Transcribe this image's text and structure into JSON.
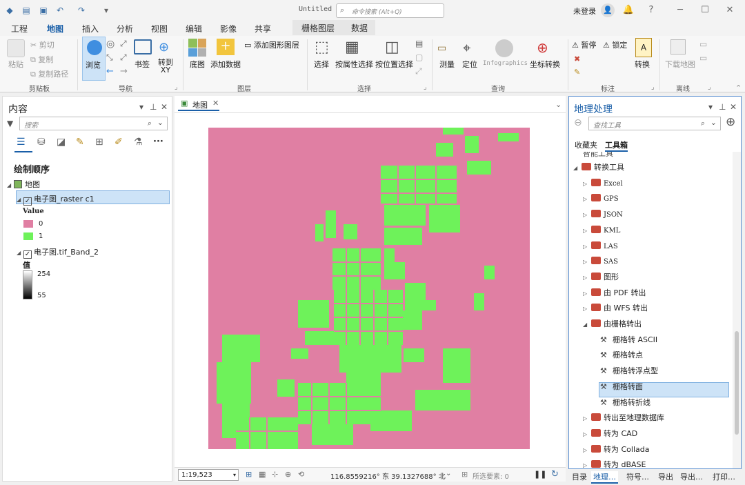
{
  "titlebar": {
    "title": "Untitled",
    "search_placeholder": "命令搜索 (Alt+Q)",
    "user": "未登录"
  },
  "ribbon_tabs": [
    "工程",
    "地图",
    "插入",
    "分析",
    "视图",
    "编辑",
    "影像",
    "共享"
  ],
  "context_tabs": [
    "栅格图层",
    "数据"
  ],
  "ribbon": {
    "clipboard": {
      "label": "剪贴板",
      "paste": "粘贴",
      "cut": "剪切",
      "copy": "复制",
      "copy_path": "复制路径"
    },
    "navigate": {
      "label": "导航",
      "explore": "浏览",
      "bookmarks": "书签",
      "goto_xy": "转到 XY"
    },
    "layer": {
      "label": "图层",
      "basemap": "底图",
      "add_data": "添加数据",
      "add_graphics": "添加图形图层"
    },
    "selection": {
      "label": "选择",
      "select": "选择",
      "by_attr": "按属性选择",
      "by_loc": "按位置选择"
    },
    "inquiry": {
      "label": "查询",
      "measure": "测量",
      "locate": "定位",
      "infographics": "Infographics",
      "coord_convert": "坐标转换"
    },
    "labeling": {
      "label": "标注",
      "pause": "暂停",
      "lock": "锁定",
      "convert": "转换"
    },
    "offline": {
      "label": "离线",
      "download_map": "下载地图"
    }
  },
  "contents": {
    "title": "内容",
    "search_placeholder": "搜索",
    "drawing_order": "绘制顺序",
    "map_node": "地图",
    "layer1": {
      "name": "电子图_raster c1",
      "value_header": "Value",
      "items": [
        {
          "label": "0",
          "color": "#e07fa3"
        },
        {
          "label": "1",
          "color": "#6ef25a"
        }
      ]
    },
    "layer2": {
      "name": "电子图.tif_Band_2",
      "value_header": "值",
      "high": "254",
      "low": "55"
    }
  },
  "map": {
    "tab_label": "地图",
    "scale": "1:19,523",
    "coords": "116.8559216° 东 39.1327688° 北",
    "selected_features": "所选要素: 0"
  },
  "geoprocessing": {
    "title": "地理处理",
    "search_placeholder": "查找工具",
    "tabs": [
      "收藏夹",
      "工具箱"
    ],
    "cut_item": "智能工具",
    "tools": [
      {
        "label": "转换工具",
        "level": 0,
        "type": "toolbox",
        "expanded": true
      },
      {
        "label": "Excel",
        "level": 1,
        "type": "toolset"
      },
      {
        "label": "GPS",
        "level": 1,
        "type": "toolset"
      },
      {
        "label": "JSON",
        "level": 1,
        "type": "toolset"
      },
      {
        "label": "KML",
        "level": 1,
        "type": "toolset"
      },
      {
        "label": "LAS",
        "level": 1,
        "type": "toolset"
      },
      {
        "label": "SAS",
        "level": 1,
        "type": "toolset"
      },
      {
        "label": "图形",
        "level": 1,
        "type": "toolset"
      },
      {
        "label": "由 PDF 转出",
        "level": 1,
        "type": "toolset"
      },
      {
        "label": "由 WFS 转出",
        "level": 1,
        "type": "toolset"
      },
      {
        "label": "由栅格转出",
        "level": 1,
        "type": "toolset",
        "expanded": true
      },
      {
        "label": "栅格转 ASCII",
        "level": 2,
        "type": "tool"
      },
      {
        "label": "栅格转点",
        "level": 2,
        "type": "tool"
      },
      {
        "label": "栅格转浮点型",
        "level": 2,
        "type": "tool"
      },
      {
        "label": "栅格转面",
        "level": 2,
        "type": "tool",
        "selected": true
      },
      {
        "label": "栅格转折线",
        "level": 2,
        "type": "tool"
      },
      {
        "label": "转出至地理数据库",
        "level": 1,
        "type": "toolset"
      },
      {
        "label": "转为 CAD",
        "level": 1,
        "type": "toolset"
      },
      {
        "label": "转为 Collada",
        "level": 1,
        "type": "toolset"
      },
      {
        "label": "转为 dBASE",
        "level": 1,
        "type": "toolset"
      }
    ]
  },
  "bottom_tabs": [
    "目录",
    "地理…",
    "符号…",
    "导出",
    "导出…",
    "打印…"
  ],
  "colors": {
    "accent": "#1a5fa8",
    "raster_bg": "#e07fa3",
    "raster_fg": "#6ef25a",
    "selection": "#cde3f7"
  }
}
